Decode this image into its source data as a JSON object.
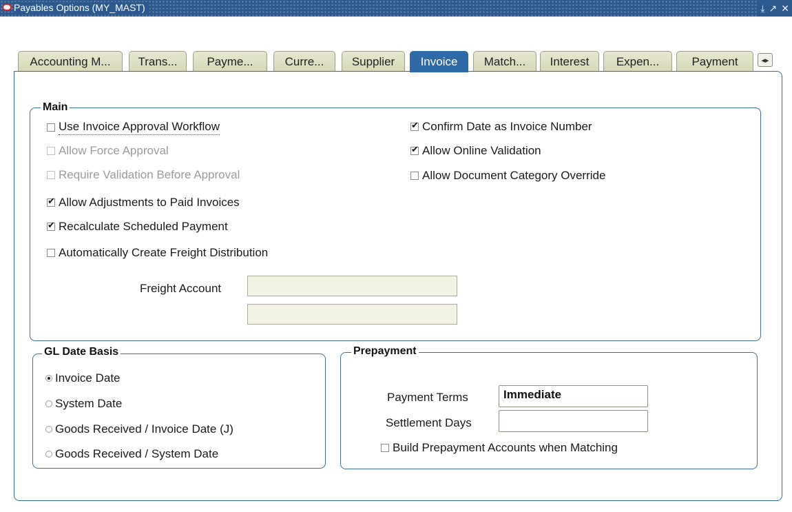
{
  "window": {
    "title": "Payables Options (MY_MAST)",
    "controls": {
      "minimize": "⤓",
      "maximize": "↗",
      "close": "✕"
    }
  },
  "tabs": [
    {
      "label": "Accounting M...",
      "active": false
    },
    {
      "label": "Trans...",
      "active": false
    },
    {
      "label": "Payme...",
      "active": false
    },
    {
      "label": "Curre...",
      "active": false
    },
    {
      "label": "Supplier",
      "active": false
    },
    {
      "label": "Invoice",
      "active": true
    },
    {
      "label": "Match...",
      "active": false
    },
    {
      "label": "Interest",
      "active": false
    },
    {
      "label": "Expen...",
      "active": false
    },
    {
      "label": "Payment",
      "active": false
    }
  ],
  "tab_scroll_icon": "scroll-arrows-icon",
  "main": {
    "legend": "Main",
    "use_invoice_approval_workflow": {
      "label": "Use Invoice Approval Workflow",
      "checked": false
    },
    "allow_force_approval": {
      "label": "Allow Force Approval",
      "checked": false,
      "disabled": true
    },
    "require_validation_before_approval": {
      "label": "Require Validation Before Approval",
      "checked": false,
      "disabled": true
    },
    "allow_adjustments_to_paid_invoices": {
      "label": "Allow Adjustments to Paid Invoices",
      "checked": true
    },
    "recalculate_scheduled_payment": {
      "label": "Recalculate Scheduled Payment",
      "checked": true
    },
    "automatically_create_freight_distribution": {
      "label": "Automatically Create Freight Distribution",
      "checked": false
    },
    "confirm_date_as_invoice_number": {
      "label": "Confirm Date as Invoice Number",
      "checked": true
    },
    "allow_online_validation": {
      "label": "Allow Online Validation",
      "checked": true
    },
    "allow_document_category_override": {
      "label": "Allow Document Category Override",
      "checked": false
    },
    "freight_account": {
      "label": "Freight Account",
      "value": "",
      "description": ""
    }
  },
  "gl_date_basis": {
    "legend": "GL Date Basis",
    "options": [
      {
        "label": "Invoice Date",
        "selected": true
      },
      {
        "label": "System Date",
        "selected": false
      },
      {
        "label": "Goods Received / Invoice Date (J)",
        "selected": false
      },
      {
        "label": "Goods Received / System Date",
        "selected": false
      }
    ]
  },
  "prepayment": {
    "legend": "Prepayment",
    "payment_terms": {
      "label": "Payment Terms",
      "value": "Immediate"
    },
    "settlement_days": {
      "label": "Settlement Days",
      "value": ""
    },
    "build_prepayment_accounts": {
      "label": "Build Prepayment Accounts when Matching",
      "checked": false
    }
  }
}
